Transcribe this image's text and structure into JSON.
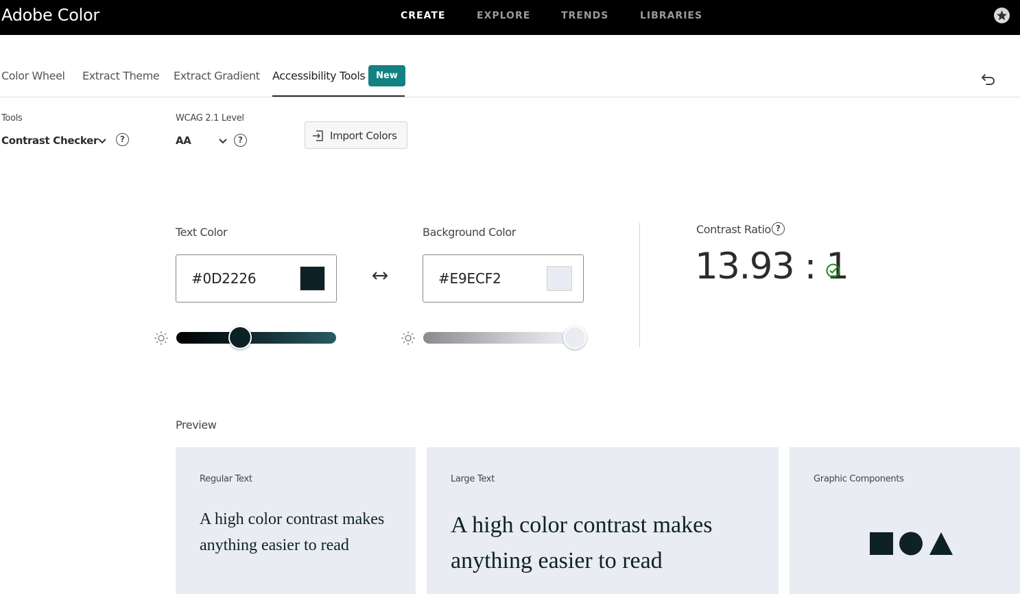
{
  "header": {
    "logo": "Adobe Color",
    "nav": [
      {
        "label": "CREATE",
        "active": true
      },
      {
        "label": "EXPLORE",
        "active": false
      },
      {
        "label": "TRENDS",
        "active": false
      },
      {
        "label": "LIBRARIES",
        "active": false
      }
    ],
    "avatar_icon": "user-avatar-icon"
  },
  "tabs": [
    {
      "label": "Color Wheel"
    },
    {
      "label": "Extract Theme"
    },
    {
      "label": "Extract Gradient"
    },
    {
      "label": "Accessibility Tools",
      "active": true
    }
  ],
  "badge": "New",
  "tools": {
    "label": "Tools",
    "value": "Contrast Checker",
    "help": "?"
  },
  "wcag": {
    "label": "WCAG 2.1 Level",
    "value": "AA",
    "help": "?"
  },
  "import_button": "Import Colors",
  "text_color": {
    "label": "Text Color",
    "hex": "#0D2226",
    "swatch": "#0D2226",
    "brightness_fraction": 0.4
  },
  "background_color": {
    "label": "Background Color",
    "hex": "#E9ECF2",
    "swatch": "#E9ECF2",
    "brightness_fraction": 0.95
  },
  "contrast": {
    "label": "Contrast Ratio",
    "help": "?",
    "value": "13.93 : 1",
    "status_color": "#1a8a1a"
  },
  "preview": {
    "label": "Preview",
    "cards": [
      {
        "title": "Regular Text",
        "text": "A high color contrast makes anything easier to read"
      },
      {
        "title": "Large Text",
        "text": "A high color contrast makes anything easier to read"
      },
      {
        "title": "Graphic Components"
      }
    ]
  }
}
